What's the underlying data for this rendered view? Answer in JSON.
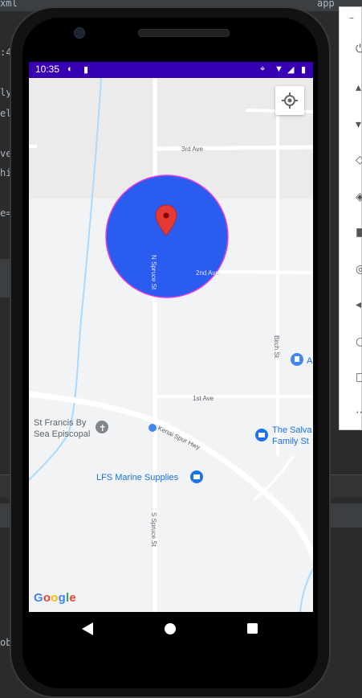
{
  "ide": {
    "file_tab": "xml",
    "right_tab": "app",
    "code_fragments": [
      ":4",
      "ly",
      "el",
      "ve",
      "hi",
      "e="
    ],
    "bottom_text": "ob"
  },
  "status_bar": {
    "time": "10:35"
  },
  "map": {
    "streets": {
      "third_ave": "3rd Ave",
      "second_ave": "2nd Ave",
      "first_ave": "1st Ave",
      "n_spruce": "N Spruce St",
      "s_spruce": "S Spruce St",
      "birch": "Birch St",
      "kenai_spur": "Kenai Spur Hwy"
    },
    "places": {
      "st_francis_line1": "St Francis By",
      "st_francis_line2": "Sea Episcopal",
      "salvation_line1": "The Salva",
      "salvation_line2": "Family St",
      "lfs": "LFS Marine Supplies",
      "a_label": "A"
    },
    "google_logo": [
      "G",
      "o",
      "o",
      "g",
      "l",
      "e"
    ],
    "colors": {
      "circle_fill": "#2b5cf0",
      "circle_stroke": "#e93ddb",
      "marker": "#e53935",
      "status_bar": "#3700b3",
      "place_blue": "#1a73e8"
    }
  },
  "icons": {
    "my_location": "my-location-icon",
    "marker": "map-marker-icon",
    "back": "back-icon",
    "home": "home-icon",
    "recents": "recents-icon"
  }
}
